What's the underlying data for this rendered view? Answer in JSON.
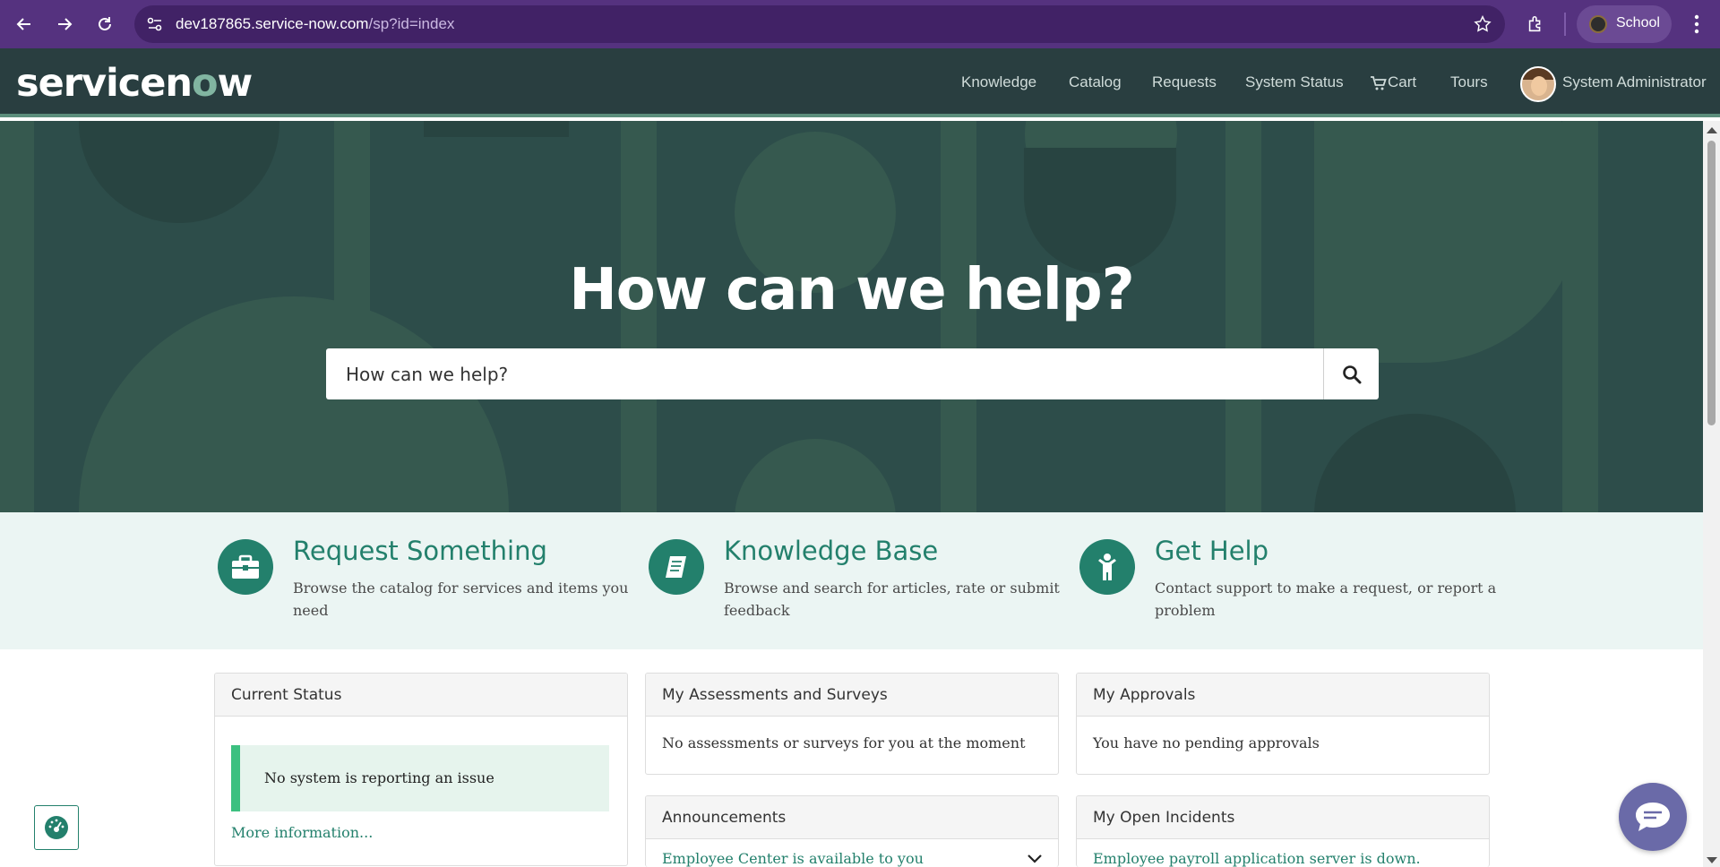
{
  "browser": {
    "url_host": "dev187865.service-now.com",
    "url_path": "/sp?id=index",
    "profile_label": "School",
    "icons": [
      "back-icon",
      "forward-icon",
      "reload-icon",
      "site-info-icon",
      "bookmark-star-icon",
      "extensions-icon",
      "menu-kebab-icon"
    ]
  },
  "header": {
    "logo_text_1": "servicen",
    "logo_text_2": "o",
    "logo_text_3": "w",
    "nav": [
      "Knowledge",
      "Catalog",
      "Requests",
      "System Status",
      "Cart",
      "Tours"
    ],
    "user_name": "System Administrator"
  },
  "hero": {
    "title": "How can we help?",
    "search_placeholder": "How can we help?"
  },
  "features": [
    {
      "title": "Request Something",
      "description": "Browse the catalog for services and items you need",
      "icon": "briefcase-icon"
    },
    {
      "title": "Knowledge Base",
      "description": "Browse and search for articles, rate or submit feedback",
      "icon": "book-icon"
    },
    {
      "title": "Get Help",
      "description": "Contact support to make a request, or report a problem",
      "icon": "person-icon"
    }
  ],
  "widgets": {
    "current_status": {
      "title": "Current Status",
      "message": "No system is reporting an issue",
      "link": "More information..."
    },
    "assessments": {
      "title": "My Assessments and Surveys",
      "message": "No assessments or surveys for you at the moment"
    },
    "approvals": {
      "title": "My Approvals",
      "message": "You have no pending approvals"
    },
    "announcements": {
      "title": "Announcements",
      "first_item": "Employee Center is available to you"
    },
    "incidents": {
      "title": "My Open Incidents",
      "first_item": "Employee payroll application server is down."
    }
  },
  "colors": {
    "browser_frame": "#55327f",
    "header_bg": "#293e40",
    "hero_bg": "#2d4d4a",
    "accent_teal": "#23806c",
    "features_bg": "#ebf5f3",
    "status_green": "#3cc080"
  }
}
